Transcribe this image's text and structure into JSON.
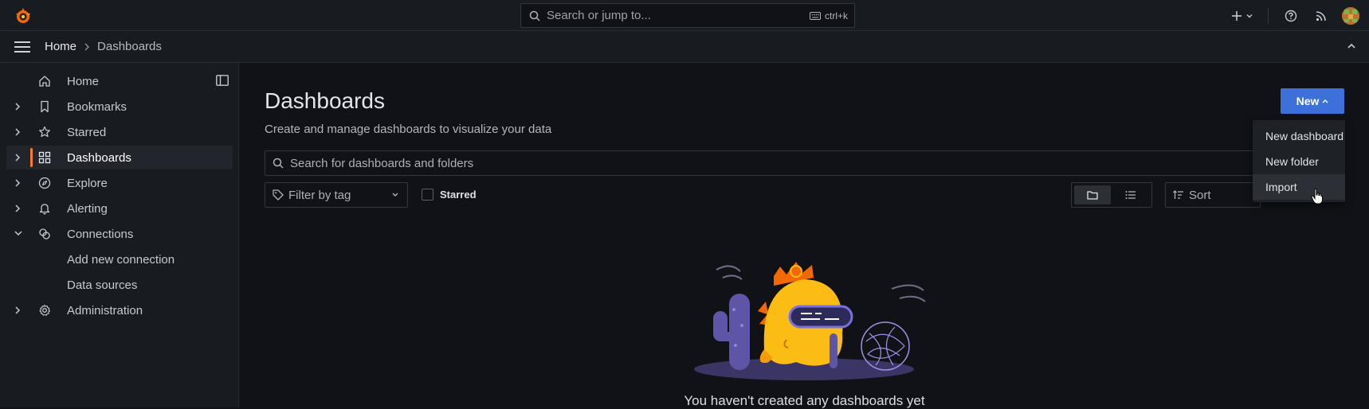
{
  "topbar": {
    "search_placeholder": "Search or jump to...",
    "search_shortcut": "ctrl+k",
    "icons": [
      "grafana-logo-icon",
      "plus-icon",
      "help-icon",
      "news-rss-icon",
      "user-avatar"
    ]
  },
  "breadcrumb": {
    "home": "Home",
    "current": "Dashboards"
  },
  "sidebar": {
    "items": [
      {
        "label": "Home",
        "icon": "home-icon",
        "expandable": false
      },
      {
        "label": "Bookmarks",
        "icon": "bookmark-icon",
        "expandable": true
      },
      {
        "label": "Starred",
        "icon": "star-icon",
        "expandable": true
      },
      {
        "label": "Dashboards",
        "icon": "apps-icon",
        "expandable": true,
        "active": true
      },
      {
        "label": "Explore",
        "icon": "compass-icon",
        "expandable": true
      },
      {
        "label": "Alerting",
        "icon": "bell-icon",
        "expandable": true
      },
      {
        "label": "Connections",
        "icon": "connections-icon",
        "expandable": true,
        "expanded": true
      },
      {
        "label": "Add new connection",
        "sub": true
      },
      {
        "label": "Data sources",
        "sub": true
      },
      {
        "label": "Administration",
        "icon": "cog-icon",
        "expandable": true
      }
    ]
  },
  "main": {
    "title": "Dashboards",
    "subtitle": "Create and manage dashboards to visualize your data",
    "new_button": "New",
    "search_placeholder": "Search for dashboards and folders",
    "filter_tag_placeholder": "Filter by tag",
    "starred_label": "Starred",
    "sort_placeholder": "Sort",
    "empty_message": "You haven't created any dashboards yet"
  },
  "new_menu": {
    "items": [
      "New dashboard",
      "New folder",
      "Import"
    ],
    "hovered": "Import"
  },
  "colors": {
    "accent_orange": "#ff7a2e",
    "primary_blue": "#3d71d9",
    "background": "#111217",
    "panel": "#181b1f"
  }
}
